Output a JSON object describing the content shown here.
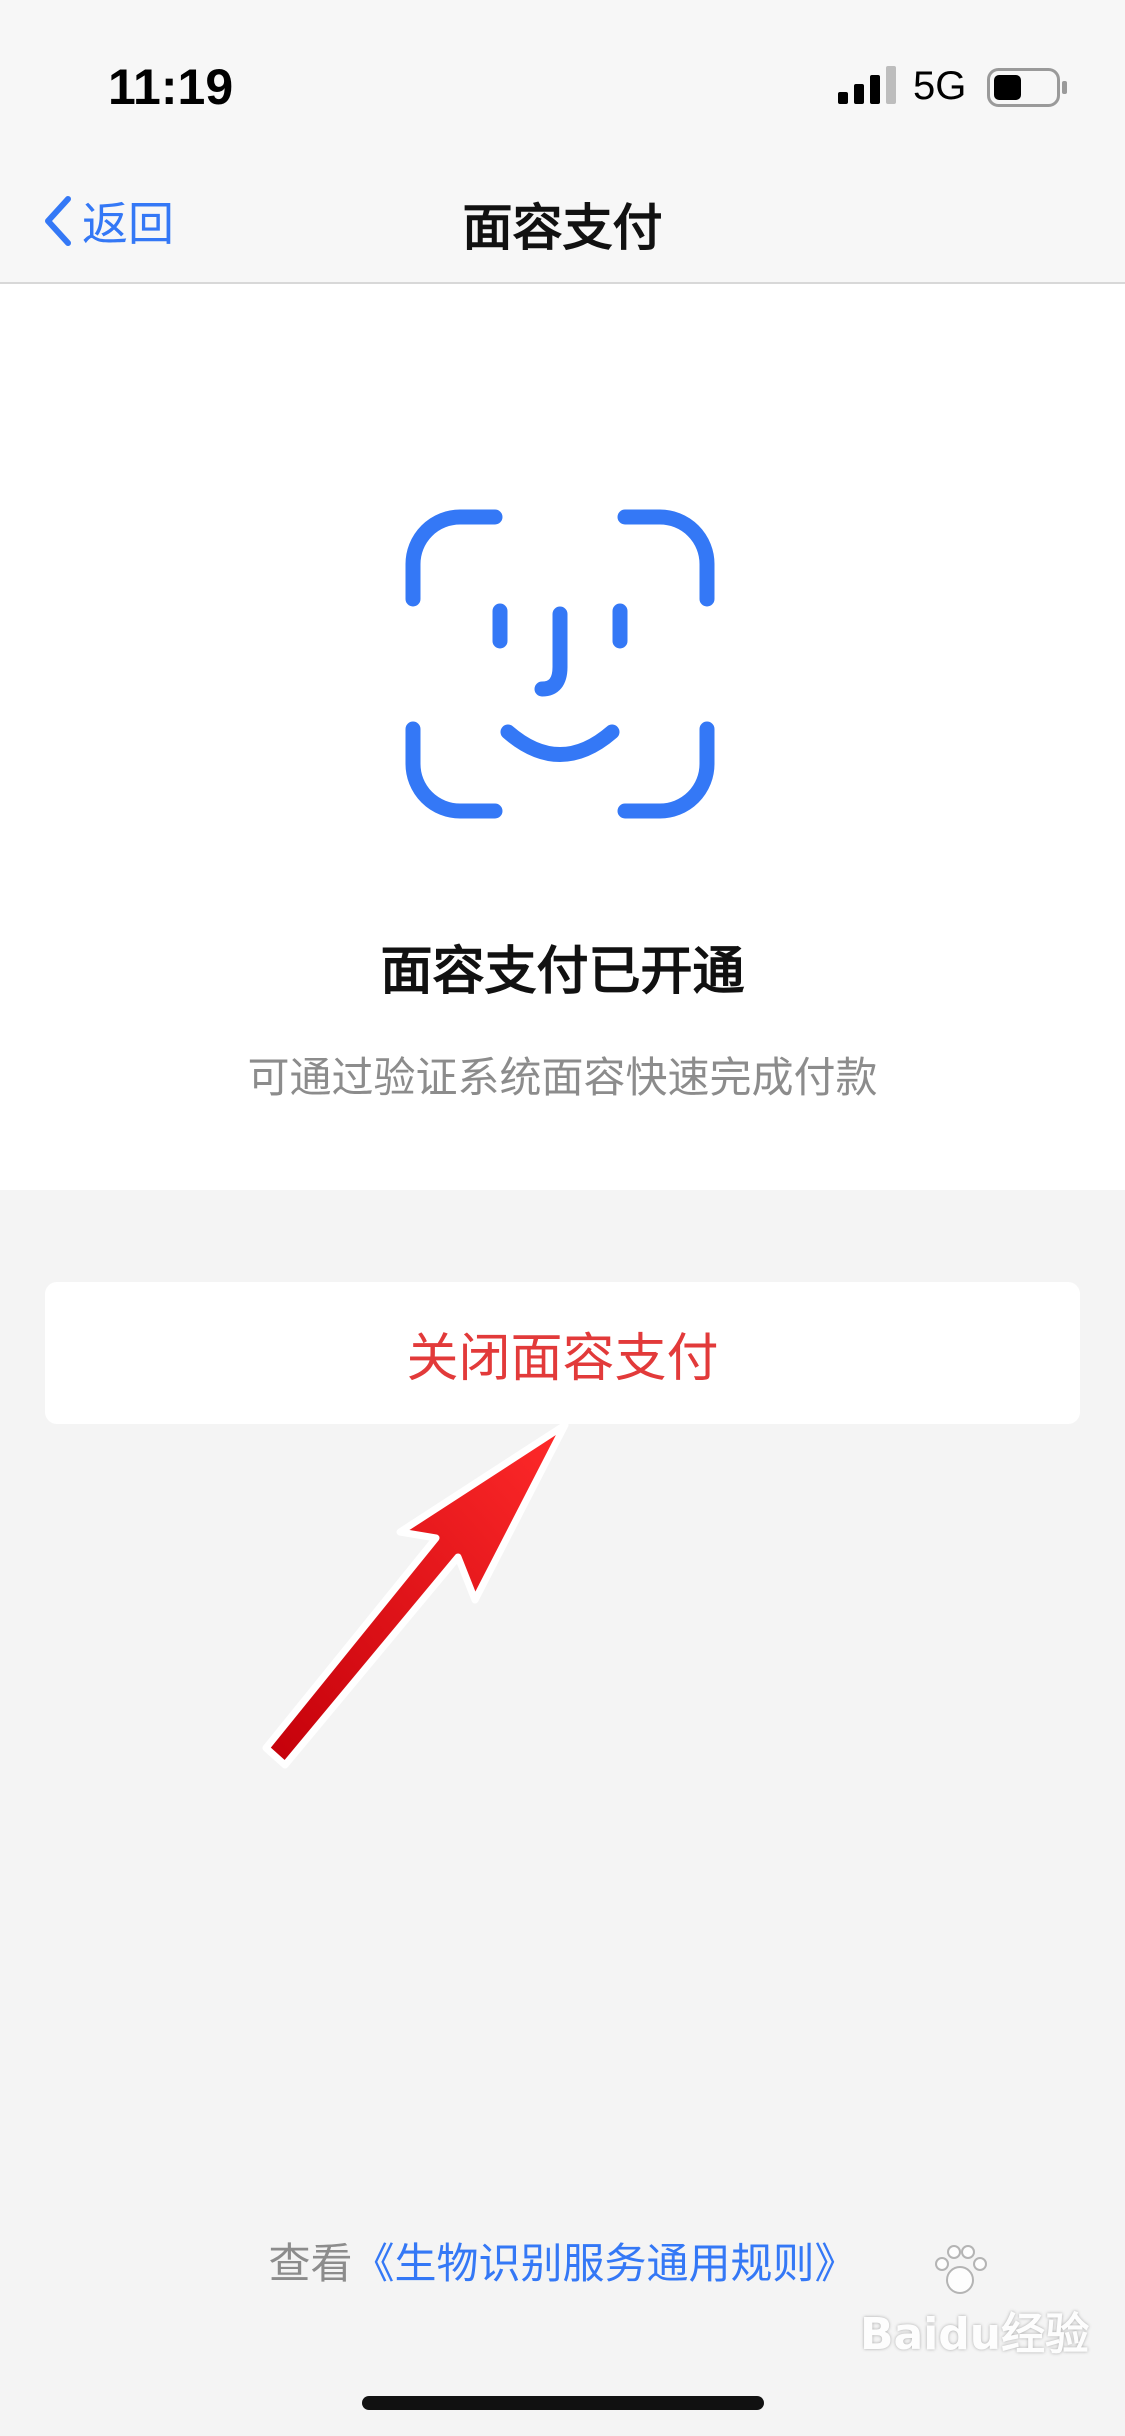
{
  "status_bar": {
    "time": "11:19",
    "network": "5G",
    "signal_icon": "cellular-signal-icon",
    "battery_icon": "battery-icon",
    "battery_level": 0.45
  },
  "nav": {
    "back_label": "返回",
    "back_icon": "chevron-left-icon",
    "title": "面容支付"
  },
  "hero": {
    "icon": "face-id-icon",
    "icon_color": "#3478f6",
    "title": "面容支付已开通",
    "subtitle": "可通过验证系统面容快速完成付款"
  },
  "actions": {
    "close_label": "关闭面容支付",
    "close_color": "#e23a3a"
  },
  "footer": {
    "rules_prefix": "查看",
    "rules_link": "《生物识别服务通用规则》"
  },
  "watermark": {
    "text": "Baidu经验"
  },
  "annotation": {
    "arrow_icon": "red-arrow-icon",
    "arrow_color": "#e8101a"
  }
}
